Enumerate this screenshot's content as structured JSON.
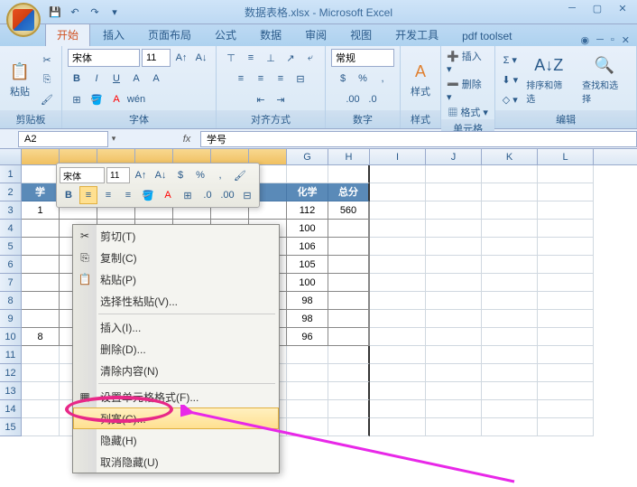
{
  "window": {
    "title": "数据表格.xlsx - Microsoft Excel",
    "qat": {
      "save": "💾",
      "undo": "↶",
      "redo": "↷"
    }
  },
  "tabs": {
    "home": "开始",
    "insert": "插入",
    "layout": "页面布局",
    "formulas": "公式",
    "data": "数据",
    "review": "审阅",
    "view": "视图",
    "dev": "开发工具",
    "pdf": "pdf toolset"
  },
  "ribbon": {
    "clipboard": {
      "label": "剪贴板",
      "paste": "粘贴"
    },
    "font": {
      "label": "字体",
      "name": "宋体",
      "size": "11"
    },
    "align": {
      "label": "对齐方式"
    },
    "number": {
      "label": "数字",
      "format": "常规"
    },
    "style": {
      "label": "样式",
      "btn": "样式"
    },
    "cells": {
      "label": "单元格",
      "insert": "插入",
      "delete": "删除",
      "format": "格式"
    },
    "editing": {
      "label": "编辑",
      "sort": "排序和筛选",
      "find": "查找和选择"
    }
  },
  "formula_bar": {
    "name_box": "A2",
    "formula": "学号"
  },
  "mini_toolbar": {
    "font": "宋体",
    "size": "11"
  },
  "context_menu": {
    "cut": "剪切(T)",
    "copy": "复制(C)",
    "paste": "粘贴(P)",
    "paste_special": "选择性粘贴(V)...",
    "insert": "插入(I)...",
    "delete": "删除(D)...",
    "clear": "清除内容(N)",
    "format_cells": "设置单元格格式(F)...",
    "col_width": "列宽(C)...",
    "hide": "隐藏(H)",
    "unhide": "取消隐藏(U)"
  },
  "columns": [
    "G",
    "H",
    "I",
    "J",
    "K",
    "L"
  ],
  "sel_cols_label_a_to_f_hidden_under_menu": true,
  "headers": {
    "g": "化学",
    "h": "总分",
    "a": "学"
  },
  "data_rows": [
    {
      "row": 3,
      "a": "1",
      "g": "112",
      "h": "560"
    },
    {
      "row": 4,
      "a": "",
      "g": "100",
      "h": ""
    },
    {
      "row": 5,
      "a": "",
      "g": "106",
      "h": ""
    },
    {
      "row": 6,
      "a": "",
      "g": "105",
      "h": ""
    },
    {
      "row": 7,
      "a": "",
      "g": "100",
      "h": ""
    },
    {
      "row": 8,
      "a": "",
      "g": "98",
      "h": ""
    },
    {
      "row": 9,
      "a": "",
      "g": "98",
      "h": ""
    },
    {
      "row": 10,
      "a": "8",
      "g": "96",
      "h": ""
    }
  ],
  "col_widths": {
    "sel": 42,
    "gh": 46,
    "rest": 62
  },
  "annotation": {
    "target": "列宽(C)..."
  }
}
